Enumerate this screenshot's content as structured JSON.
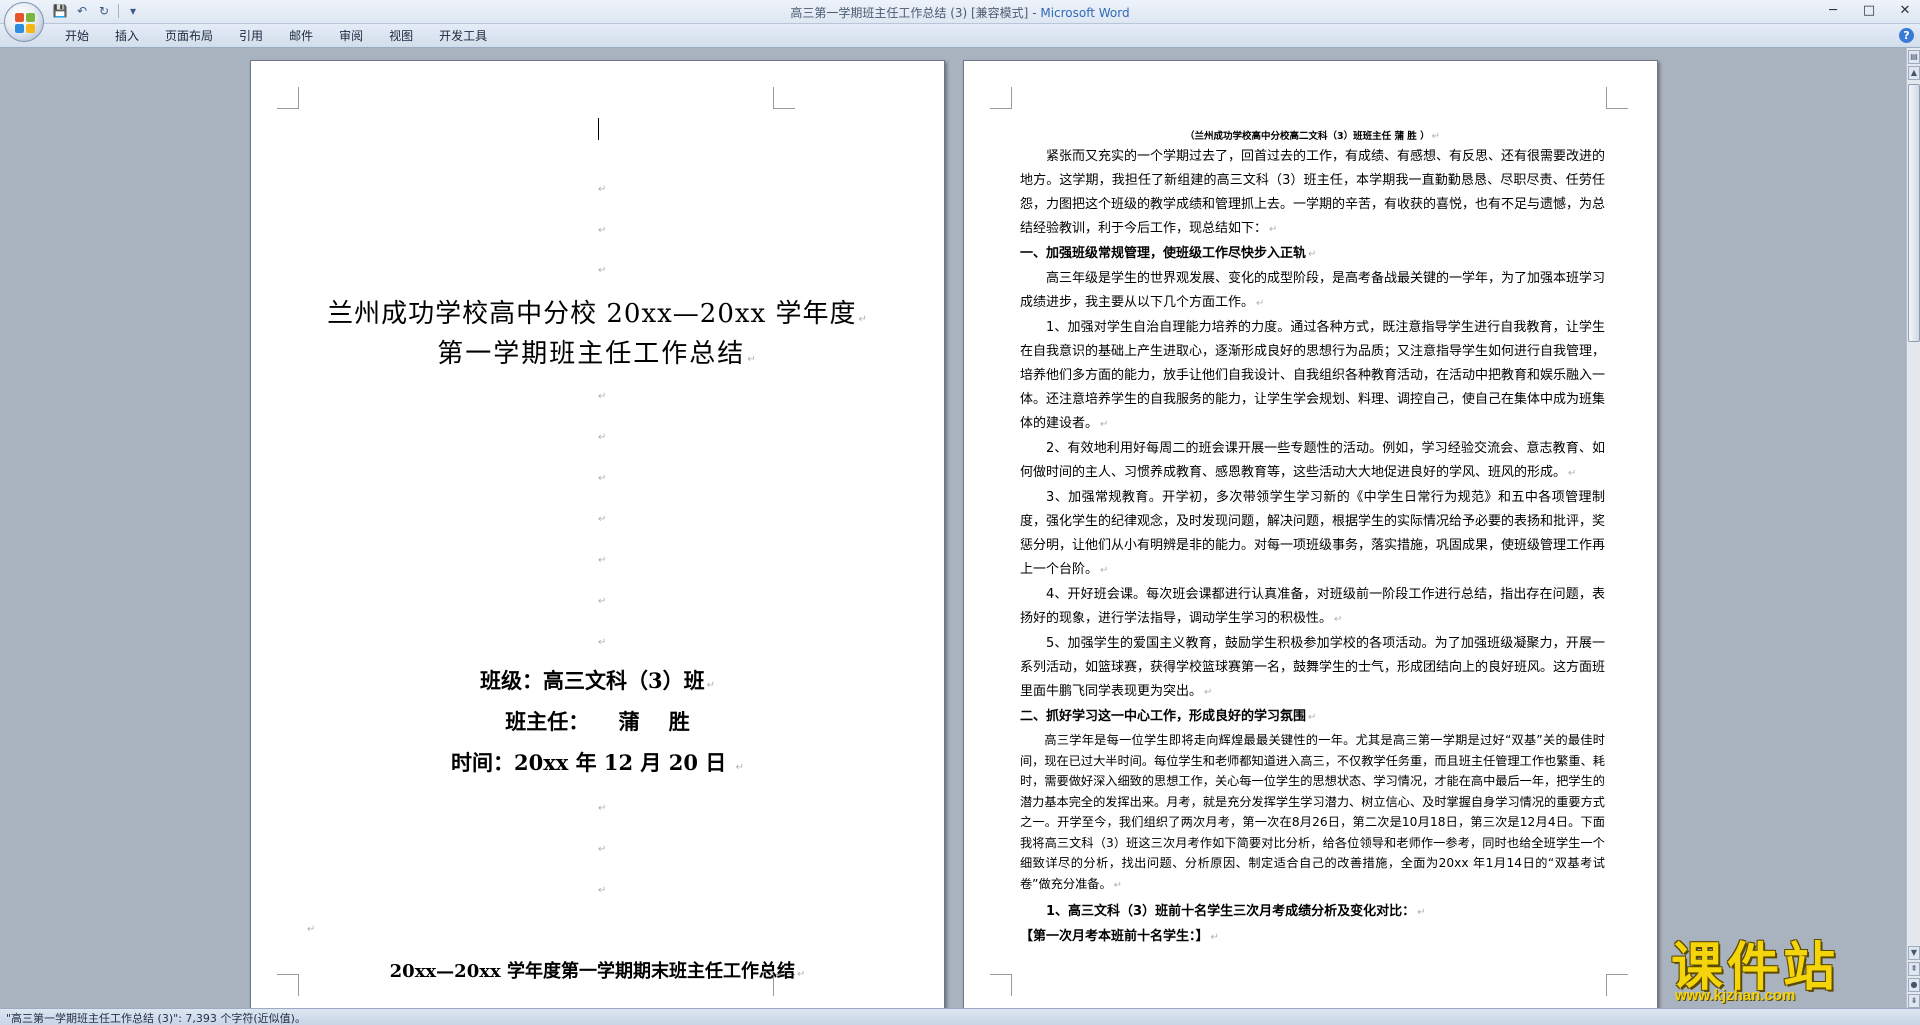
{
  "window": {
    "title": "高三第一学期班主任工作总结 (3) [兼容模式]",
    "title_sep": " - ",
    "app_name": "Microsoft Word"
  },
  "qat": {
    "save_icon": "💾",
    "undo_icon": "↶",
    "redo_icon": "↻",
    "more_icon": "▾"
  },
  "controls": {
    "minimize": "─",
    "maximize": "□",
    "close": "✕"
  },
  "tabs": [
    "开始",
    "插入",
    "页面布局",
    "引用",
    "邮件",
    "审阅",
    "视图",
    "开发工具"
  ],
  "help_icon": "?",
  "cover": {
    "title_line1": "兰州成功学校高中分校 20xx—20xx 学年度",
    "title_line2": "第一学期班主任工作总结",
    "class": "班级：高三文科（3）班",
    "teacher": "班主任：    蒲    胜",
    "time": "时间：20xx 年 12 月 20 日 ",
    "footer": "20xx—20xx 学年度第一学期期末班主任工作总结"
  },
  "right_page": {
    "header": "（兰州成功学校高中分校高二文科（3）班班主任    蒲  胜 ）",
    "paragraphs": [
      "紧张而又充实的一个学期过去了，回首过去的工作，有成绩、有感想、有反思、还有很需要改进的地方。这学期，我担任了新组建的高三文科（3）班主任，本学期我一直勤勤恳恳、尽职尽责、任劳任怨，力图把这个班级的教学成绩和管理抓上去。一学期的辛苦，有收获的喜悦，也有不足与遗憾，为总结经验教训，利于今后工作，现总结如下：",
      "一、加强班级常规管理，使班级工作尽快步入正轨",
      "高三年级是学生的世界观发展、变化的成型阶段，是高考备战最关键的一学年，为了加强本班学习成绩进步，我主要从以下几个方面工作。",
      "1、加强对学生自治自理能力培养的力度。通过各种方式，既注意指导学生进行自我教育，让学生在自我意识的基础上产生进取心，逐渐形成良好的思想行为品质；又注意指导学生如何进行自我管理，培养他们多方面的能力，放手让他们自我设计、自我组织各种教育活动，在活动中把教育和娱乐融入一体。还注意培养学生的自我服务的能力，让学生学会规划、料理、调控自己，使自己在集体中成为班集体的建设者。",
      "2、有效地利用好每周二的班会课开展一些专题性的活动。例如，学习经验交流会、意志教育、如何做时间的主人、习惯养成教育、感恩教育等，这些活动大大地促进良好的学风、班风的形成。",
      "3、加强常规教育。开学初，多次带领学生学习新的《中学生日常行为规范》和五中各项管理制度，强化学生的纪律观念，及时发现问题，解决问题，根据学生的实际情况给予必要的表扬和批评，奖惩分明，让他们从小有明辨是非的能力。对每一项班级事务，落实措施，巩固成果，使班级管理工作再上一个台阶。",
      "4、开好班会课。每次班会课都进行认真准备，对班级前一阶段工作进行总结，指出存在问题，表扬好的现象，进行学法指导，调动学生学习的积极性。",
      "5、加强学生的爱国主义教育，鼓励学生积极参加学校的各项活动。为了加强班级凝聚力，开展一系列活动，如篮球赛，获得学校篮球赛第一名，鼓舞学生的士气，形成团结向上的良好班风。这方面班里面牛鹏飞同学表现更为突出。",
      "二、抓好学习这一中心工作，形成良好的学习氛围",
      "高三学年是每一位学生即将走向辉煌最最关键性的一年。尤其是高三第一学期是过好“双基”关的最佳时间，现在已过大半时间。每位学生和老师都知道进入高三，不仅教学任务重，而且班主任管理工作也繁重、耗时，需要做好深入细致的思想工作，关心每一位学生的思想状态、学习情况，才能在高中最后一年，把学生的潜力基本完全的发挥出来。月考，就是充分发挥学生学习潜力、树立信心、及时掌握自身学习情况的重要方式之一。开学至今，我们组织了两次月考，第一次在8月26日，第二次是10月18日，第三次是12月4日。下面我将高三文科（3）班这三次月考作如下简要对比分析，给各位领导和老师作一参考，同时也给全班学生一个细致详尽的分析，找出问题、分析原因、制定适合自己的改善措施，全面为20xx 年1月14日的“双基考试卷”做充分准备。",
      "1、高三文科（3）班前十名学生三次月考成绩分析及变化对比：",
      "【第一次月考本班前十名学生：】"
    ]
  },
  "status": {
    "text": "\"高三第一学期班主任工作总结 (3)\": 7,393 个字符(近似值)。"
  },
  "watermark": {
    "main": "课件站",
    "url": "www.kjzhan.com"
  },
  "paragraph_mark": "↵",
  "colors": {
    "app_blue": "#2f6ab8",
    "workspace": "#a9b2bf",
    "watermark_yellow": "#f4d40a"
  }
}
